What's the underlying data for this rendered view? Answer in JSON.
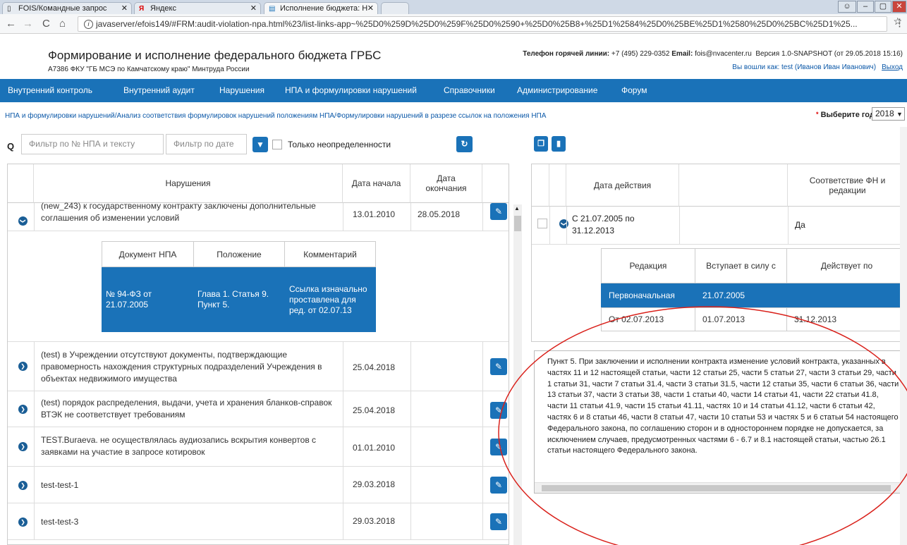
{
  "browser": {
    "tabs": [
      {
        "label": "FOIS/Командные запрос",
        "icon": "page-icon"
      },
      {
        "label": "Яндекс",
        "icon": "yandex-icon"
      },
      {
        "label": "Исполнение бюджета: Н",
        "icon": "doc-icon"
      }
    ],
    "url": "javaserver/efois149/#FRM:audit-violation-npa.html%23/list-links-app~%25D0%259D%25D0%259F%25D0%2590+%25D0%25B8+%25D1%2584%25D0%25BE%25D1%2580%25D0%25BC%25D1%25..."
  },
  "header": {
    "title": "Формирование и исполнение федерального бюджета ГРБС",
    "org": "А7386 ФКУ \"ГБ МСЭ по Камчатскому краю\" Минтруда России",
    "hotline_label": "Телефон горячей линии:",
    "hotline_value": "+7 (495) 229-0352",
    "email_label": "Email:",
    "email_value": "fois@nvacenter.ru",
    "version": "Версия 1.0-SNAPSHOT (от 29.05.2018 15:16)",
    "user": "Вы вошли как: test (Иванов Иван Иванович)",
    "logout": "Выход"
  },
  "menu": [
    "Внутренний контроль",
    "Внутренний аудит",
    "Нарушения",
    "НПА и формулировки нарушений",
    "Справочники",
    "Администрирование",
    "Форум"
  ],
  "breadcrumb": "НПА и формулировки нарушений/Анализ соответствия формулировок нарушений положениям НПА/Формулировки нарушений в разрезе ссылок на положения НПА",
  "year": {
    "label": "Выберите год:",
    "value": "2018"
  },
  "filters": {
    "text_placeholder": "Фильтр по № НПА и тексту",
    "date_placeholder": "Фильтр по дате",
    "only_undefined": "Только неопределенности"
  },
  "left_table": {
    "headers": [
      "Нарушения",
      "Дата начала",
      "Дата окончания"
    ],
    "rows": [
      {
        "text": "(new_243) к государственному контракту заключены дополнительные соглашения об изменении условий",
        "start": "13.01.2010",
        "end": "28.05.2018"
      },
      {
        "text": "(test) в Учреждении отсутствуют документы, подтверждающие правомерность нахождения структурных подразделений Учреждения в объектах недвижимого имущества",
        "start": "25.04.2018",
        "end": ""
      },
      {
        "text": "(test) порядок распределения, выдачи, учета и хранения бланков-справок ВТЭК не соответствует требованиям",
        "start": "25.04.2018",
        "end": ""
      },
      {
        "text": "TEST.Buraeva. не осуществлялась аудиозапись вскрытия конвертов с заявками на участие в запросе котировок",
        "start": "01.01.2010",
        "end": ""
      },
      {
        "text": "test-test-1",
        "start": "29.03.2018",
        "end": ""
      },
      {
        "text": "test-test-3",
        "start": "29.03.2018",
        "end": ""
      }
    ],
    "nested": {
      "headers": [
        "Документ НПА",
        "Положение",
        "Комментарий"
      ],
      "row": [
        "№ 94-ФЗ от 21.07.2005",
        "Глава 1. Статья 9. Пункт 5.",
        "Ссылка изначально проставлена для ред. от 02.07.13"
      ]
    }
  },
  "right_table": {
    "headers": [
      "Дата действия",
      "",
      "Соответствие ФН и редакции"
    ],
    "row": {
      "period": "С 21.07.2005 по 31.12.2013",
      "match": "Да"
    },
    "sub_headers": [
      "Редакция",
      "Вступает в силу с",
      "Действует по"
    ],
    "sub_rows": [
      [
        "Первоначальная",
        "21.07.2005",
        ""
      ],
      [
        "От 02.07.2013",
        "01.07.2013",
        "31.12.2013"
      ]
    ],
    "text": "Пункт 5. При заключении и исполнении контракта изменение условий контракта, указанных в частях 11 и 12 настоящей статьи, части 12 статьи 25, части 5 статьи 27, части 3 статьи 29, части 1 статьи 31, части 7 статьи 31.4, части 3 статьи 31.5, части 12 статьи 35, части 6 статьи 36, части 13 статьи 37, части 3 статьи 38, части 1 статьи 40, части 14 статьи 41, части 22 статьи 41.8, части 11 статьи 41.9, части 15 статьи 41.11, частях 10 и 14 статьи 41.12, части 6 статьи 42, частях 6 и 8 статьи 46, части 8 статьи 47, части 10 статьи 53 и частях 5 и 6 статьи 54 настоящего Федерального закона, по соглашению сторон и в одностороннем порядке не допускается, за исключением случаев, предусмотренных частями 6 - 6.7 и 8.1 настоящей статьи, частью 26.1 статьи настоящего Федерального закона."
  },
  "colors": {
    "accent": "#1a72b8",
    "annotation": "#d9201a"
  }
}
